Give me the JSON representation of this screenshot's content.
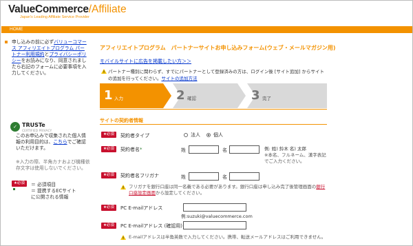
{
  "header": {
    "logo_main": "ValueCommerce",
    "logo_slash": "/",
    "logo_sub": "Affiliate",
    "tagline": "Japan's Leading Affiliate Service Provider",
    "nav_home": "HOME"
  },
  "sidebar": {
    "intro_1": "申し込みの前に必ず",
    "intro_link_1": "バリューコマース アフィリエイトプログラム パートナー利用規約",
    "intro_2": "と",
    "intro_link_2": "プライバシーポリシー",
    "intro_3": "をお読みになり、同意されましたら右記のフォームに必要事項を入力してください。",
    "truste_name": "TRUSTe",
    "truste_sub": "CERTIFIED PRIVACY",
    "privacy_1": "このお申込みで収集された個人情報の利用目的は、",
    "privacy_link": "こちら",
    "privacy_2": "でご確認いただけます。",
    "note": "※入力の際、半角カナおよび機種依存文字は使用しないでください。",
    "legend_required_badge": "★必須",
    "legend_required_label": "＝ 必須項目",
    "legend_ec_label": "＝ 提携するECサイトに公開される情報"
  },
  "main": {
    "title": "アフィリエイトプログラム　パートナーサイトお申し込みフォーム(ウェブ・メールマガジン用)",
    "mobile_link": "モバイルサイトに広告を掲載したい方＞＞",
    "info_text": "パートナー種別に関わらず、すでにパートナーとして登録済みの方は、ログイン後 [サイト追加] からサイトの追加を行ってください。",
    "info_link": "サイトの追加方法",
    "steps": [
      {
        "num": "1",
        "label": "入力"
      },
      {
        "num": "2",
        "label": "確認"
      },
      {
        "num": "3",
        "label": "完了"
      }
    ],
    "section_title": "サイトの契約者情報",
    "required_badge": "★必須",
    "contract_type_label": "契約者タイプ",
    "corp_label": "法人",
    "individual_label": "個人",
    "selected_type": "個人",
    "name_label": "契約者名",
    "sei_label": "姓",
    "mei_label": "名",
    "name_example": "例: 姓) 鈴木  名) 太郎",
    "name_note": "※本名、フルネーム、漢字表記でご入力ください。",
    "kana_label": "契約者名フリガナ",
    "kana_sei_label": "姓",
    "kana_mei_label": "名",
    "kana_warn_1": "フリガナを銀行口座は同一名義である必要があります。銀行口座は申し込み完了後管理画面の",
    "kana_warn_link": "銀行口座設定画面",
    "kana_warn_2": "から設定してください。",
    "email_label": "PC E-mailアドレス",
    "email_example": "例:suzuki@valuecommerce.com",
    "email_confirm_label": "PC E-mailアドレス (確認用)",
    "email_warn": "E-mailアドレスは半角英数で入力してください。携帯、転送メールアドレスはご利用できません。"
  },
  "colors": {
    "accent": "#f39200",
    "required": "#c8102e",
    "link": "#0033cc"
  }
}
